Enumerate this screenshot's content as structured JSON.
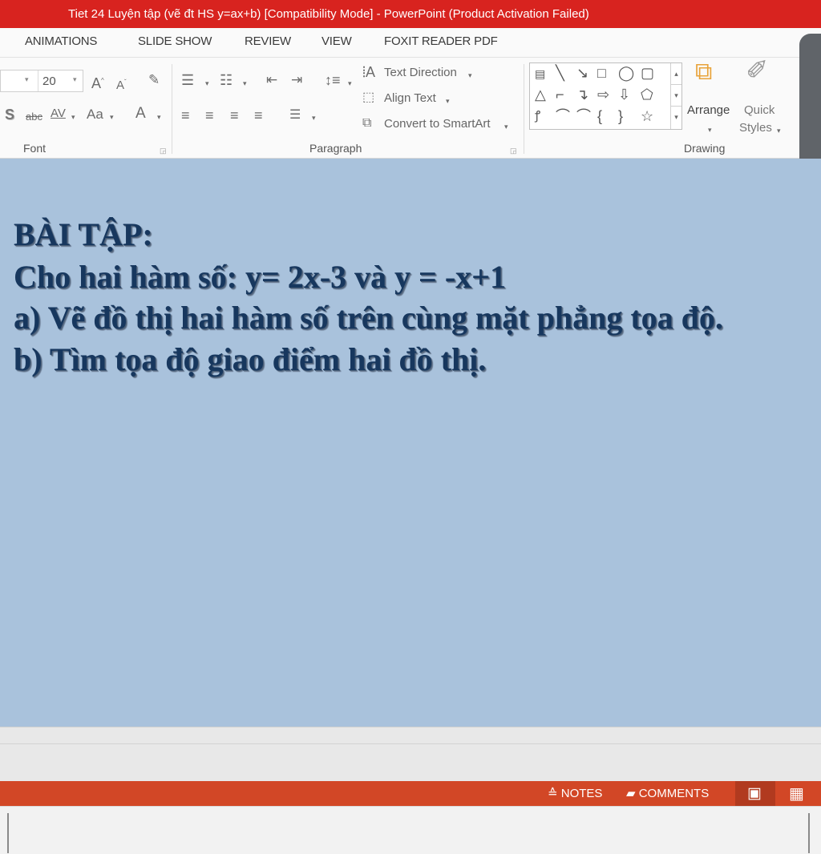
{
  "window": {
    "title": "Tiet 24  Luyện tập (vẽ đt HS y=ax+b) [Compatibility Mode] -  PowerPoint (Product Activation Failed)"
  },
  "tabs": [
    "ANIMATIONS",
    "SLIDE SHOW",
    "REVIEW",
    "VIEW",
    "FOXIT READER PDF"
  ],
  "ribbon": {
    "font_size": "20",
    "text_direction": "Text Direction",
    "align_text": "Align Text",
    "convert_smartart": "Convert to SmartArt",
    "arrange": "Arrange",
    "quick_styles_1": "Quick",
    "quick_styles_2": "Styles",
    "group_font": "Font",
    "group_paragraph": "Paragraph",
    "group_drawing": "Drawing",
    "strike": "abc",
    "char_spacing": "AV",
    "change_case": "Aa",
    "font_color": "A",
    "shadow": "S"
  },
  "slide": {
    "heading": "BÀI TẬP:",
    "line1": "Cho hai hàm số: y= 2x-3 và y = -x+1",
    "line2": "a)  Vẽ đồ thị hai hàm số trên cùng mặt phẳng tọa độ.",
    "line3": "b)  Tìm tọa độ giao điểm hai đồ thị."
  },
  "statusbar": {
    "notes": "NOTES",
    "comments": "COMMENTS"
  },
  "colors": {
    "titlebar": "#d8231f",
    "statusbar": "#d24726",
    "slide_bg": "#a9c2dc",
    "slide_text": "#17375e"
  }
}
